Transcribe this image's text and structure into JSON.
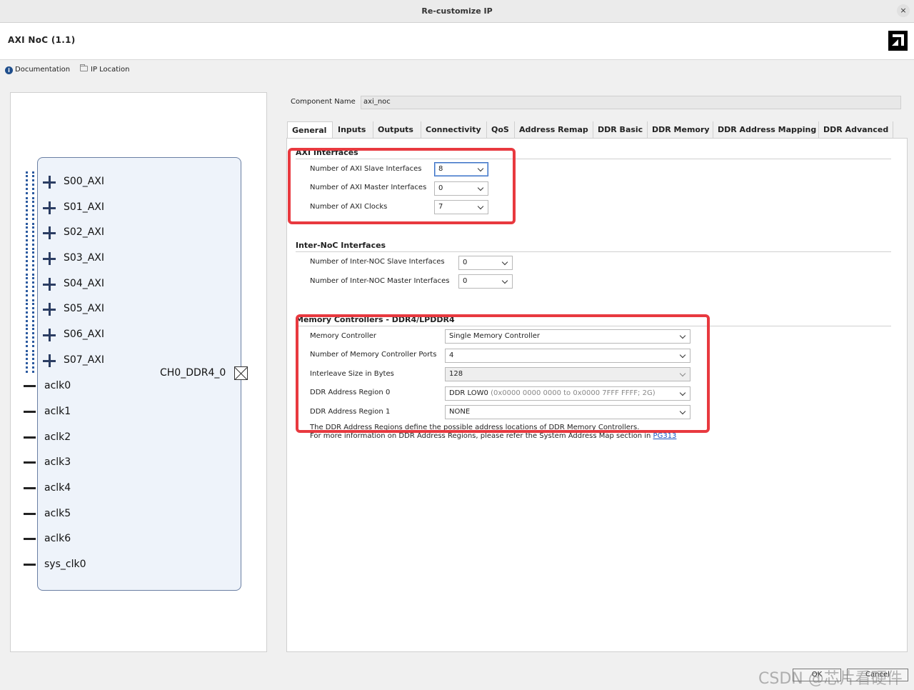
{
  "window": {
    "title": "Re-customize IP",
    "close_glyph": "×"
  },
  "header": {
    "ip_name": "AXI NoC (1.1)"
  },
  "toolbar": {
    "documentation": "Documentation",
    "ip_location": "IP Location"
  },
  "symbol": {
    "slave_ports": [
      "S00_AXI",
      "S01_AXI",
      "S02_AXI",
      "S03_AXI",
      "S04_AXI",
      "S05_AXI",
      "S06_AXI",
      "S07_AXI"
    ],
    "clock_ports": [
      "aclk0",
      "aclk1",
      "aclk2",
      "aclk3",
      "aclk4",
      "aclk5",
      "aclk6",
      "sys_clk0"
    ],
    "output_port": "CH0_DDR4_0"
  },
  "component": {
    "label": "Component Name",
    "value": "axi_noc"
  },
  "tabs": [
    "General",
    "Inputs",
    "Outputs",
    "Connectivity",
    "QoS",
    "Address Remap",
    "DDR Basic",
    "DDR Memory",
    "DDR Address Mapping",
    "DDR Advanced"
  ],
  "axi_interfaces": {
    "title": "AXI Interfaces",
    "slave_label": "Number of AXI Slave Interfaces",
    "slave_value": "8",
    "master_label": "Number of AXI Master Interfaces",
    "master_value": "0",
    "clocks_label": "Number of AXI Clocks",
    "clocks_value": "7"
  },
  "inter_noc": {
    "title": "Inter-NoC Interfaces",
    "slave_label": "Number of Inter-NOC Slave Interfaces",
    "slave_value": "0",
    "master_label": "Number of Inter-NOC Master Interfaces",
    "master_value": "0"
  },
  "memory_controllers": {
    "title": "Memory Controllers - DDR4/LPDDR4",
    "controller_label": "Memory Controller",
    "controller_value": "Single Memory Controller",
    "ports_label": "Number of Memory Controller Ports",
    "ports_value": "4",
    "interleave_label": "Interleave Size in Bytes",
    "interleave_value": "128",
    "region0_label": "DDR Address Region 0",
    "region0_value": "DDR LOW0",
    "region0_detail": "(0x0000 0000 0000 to 0x0000 7FFF FFFF; 2G)",
    "region1_label": "DDR Address Region 1",
    "region1_value": "NONE",
    "note1": "The DDR Address Regions define the possible address locations of DDR Memory Controllers.",
    "note2": "For more information on DDR Address Regions, please refer the System Address Map section in",
    "note_link": "PG313"
  },
  "footer": {
    "ok": "OK",
    "cancel": "Cancel"
  },
  "watermark": "CSDN @芯片看硬件",
  "colors": {
    "highlight": "#e8393f",
    "link": "#1a55c2",
    "symbol_port": "#2b3d63",
    "symbol_block": "#eef3fa"
  }
}
